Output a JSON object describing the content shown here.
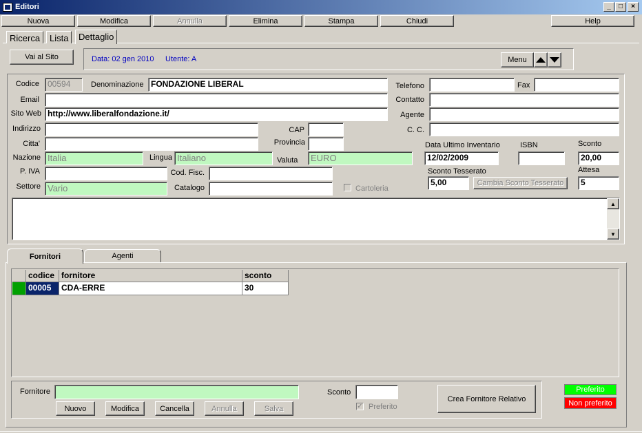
{
  "window": {
    "title": "Editori"
  },
  "menu": {
    "nuova": "Nuova",
    "modifica": "Modifica",
    "annulla": "Annulla",
    "elimina": "Elimina",
    "stampa": "Stampa",
    "chiudi": "Chiudi",
    "help": "Help"
  },
  "tabs": {
    "ricerca": "Ricerca",
    "lista": "Lista",
    "dettaglio": "Dettaglio"
  },
  "toolbar": {
    "vai_al_sito": "Vai al Sito",
    "data": "Data: 02 gen 2010",
    "utente": "Utente: A",
    "menu": "Menu"
  },
  "form": {
    "codice_label": "Codice",
    "codice": "00594",
    "denominazione_label": "Denominazione",
    "denominazione": "FONDAZIONE LIBERAL",
    "telefono_label": "Telefono",
    "telefono": "",
    "fax_label": "Fax",
    "fax": "",
    "email_label": "Email",
    "email": "",
    "contatto_label": "Contatto",
    "contatto": "",
    "sito_label": "Sito Web",
    "sito": "http://www.liberalfondazione.it/",
    "agente_label": "Agente",
    "agente": "",
    "indirizzo_label": "Indirizzo",
    "indirizzo": "",
    "cap_label": "CAP",
    "cap": "",
    "cc_label": "C. C.",
    "cc": "",
    "citta_label": "Citta'",
    "citta": "",
    "provincia_label": "Provincia",
    "provincia": "",
    "nazione_label": "Nazione",
    "nazione": "Italia",
    "lingua_label": "Lingua",
    "lingua": "Italiano",
    "valuta_label": "Valuta",
    "valuta": "EURO",
    "piva_label": "P. IVA",
    "piva": "",
    "codfisc_label": "Cod. Fisc.",
    "codfisc": "",
    "settore_label": "Settore",
    "settore": "Vario",
    "catalogo_label": "Catalogo",
    "catalogo": "",
    "cartoleria_label": "Cartoleria",
    "data_inv_label": "Data Ultimo Inventario",
    "data_inv": "12/02/2009",
    "isbn_label": "ISBN",
    "isbn": "",
    "sconto_label": "Sconto",
    "sconto": "20,00",
    "sconto_tess_label": "Sconto Tesserato",
    "sconto_tess": "5,00",
    "cambia_sconto": "Cambia Sconto Tesserato",
    "attesa_label": "Attesa",
    "attesa": "5"
  },
  "subtabs": {
    "fornitori": "Fornitori",
    "agenti": "Agenti"
  },
  "grid": {
    "columns": [
      "codice",
      "fornitore",
      "sconto"
    ],
    "rows": [
      {
        "codice": "00005",
        "fornitore": "CDA-ERRE",
        "sconto": "30"
      }
    ]
  },
  "bottom": {
    "fornitore_label": "Fornitore",
    "fornitore": "",
    "sconto_label": "Sconto",
    "sconto": "",
    "preferito_label": "Preferito",
    "nuovo": "Nuovo",
    "modifica": "Modifica",
    "cancella": "Cancella",
    "annulla": "Annulla",
    "salva": "Salva",
    "crea": "Crea Fornitore Relativo"
  },
  "legend": {
    "preferito": "Preferito",
    "preferito_color": "#00ff00",
    "non_preferito": "Non preferito",
    "non_preferito_color": "#ff0000"
  }
}
